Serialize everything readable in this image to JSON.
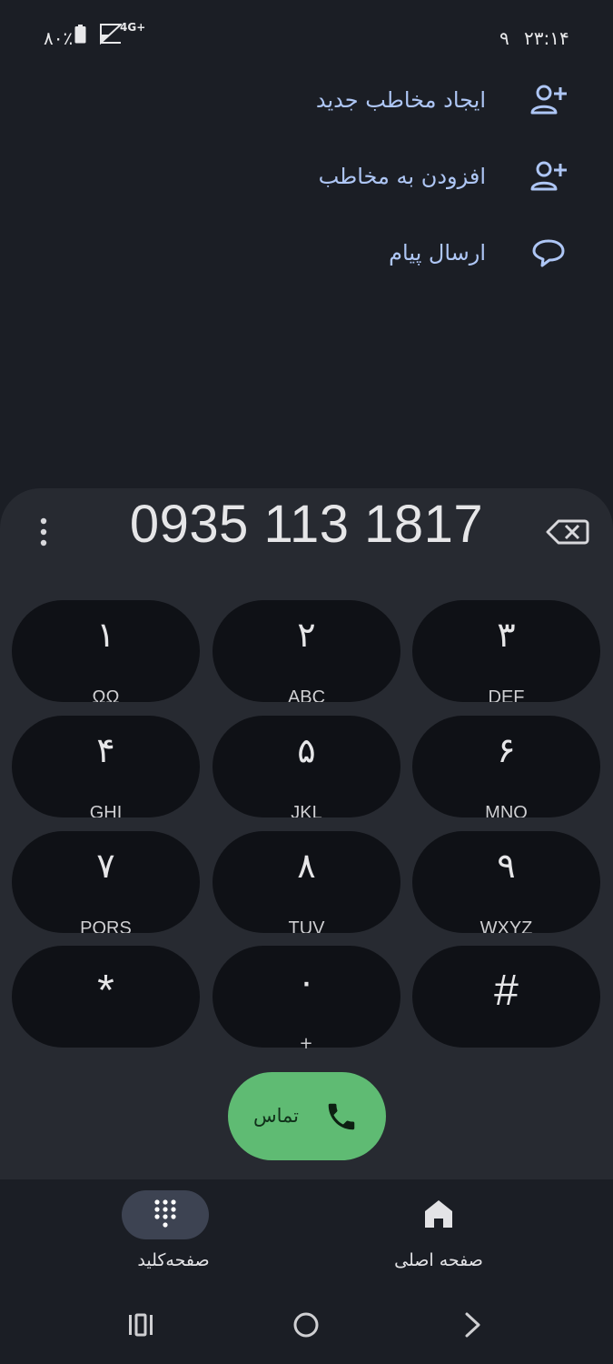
{
  "status_bar": {
    "battery_percent": "۸۰٪",
    "network": "4G+",
    "notification_count": "۹",
    "time": "۲۳:۱۴"
  },
  "actions": [
    {
      "label": "ایجاد مخاطب جدید",
      "icon": "add-person-icon"
    },
    {
      "label": "افزودن به مخاطب",
      "icon": "add-person-icon"
    },
    {
      "label": "ارسال پیام",
      "icon": "message-bubble-icon"
    }
  ],
  "dialer": {
    "number": "0935 113 1817",
    "keys": [
      {
        "digit": "۱",
        "letters": "ΩΩ"
      },
      {
        "digit": "۲",
        "letters": "ABC"
      },
      {
        "digit": "۳",
        "letters": "DEF"
      },
      {
        "digit": "۴",
        "letters": "GHI"
      },
      {
        "digit": "۵",
        "letters": "JKL"
      },
      {
        "digit": "۶",
        "letters": "MNO"
      },
      {
        "digit": "۷",
        "letters": "PQRS"
      },
      {
        "digit": "۸",
        "letters": "TUV"
      },
      {
        "digit": "۹",
        "letters": "WXYZ"
      },
      {
        "digit": "*",
        "letters": ""
      },
      {
        "digit": "۰",
        "letters": "+"
      },
      {
        "digit": "#",
        "letters": ""
      }
    ],
    "call_label": "تماس"
  },
  "bottom_nav": {
    "keypad_label": "صفحه‌کلید",
    "home_label": "صفحه اصلی"
  },
  "colors": {
    "background": "#1b1e25",
    "panel": "#272a31",
    "key": "#0f1116",
    "accent_blue": "#aec6f5",
    "call_green": "#5fbb73",
    "nav_pill": "#3d4352"
  }
}
